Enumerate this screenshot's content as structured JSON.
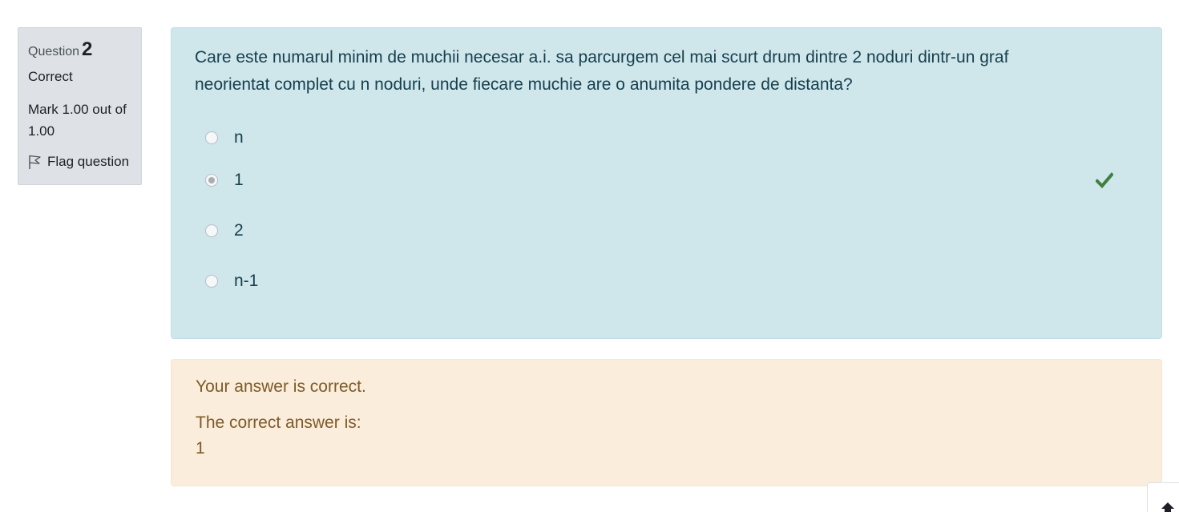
{
  "info": {
    "question_prefix": "Question",
    "question_number": "2",
    "state": "Correct",
    "grade": "Mark 1.00 out of 1.00",
    "flag_label": "Flag question",
    "flag_icon": "flag-icon"
  },
  "question": {
    "text": "Care este numarul minim de muchii necesar a.i. sa parcurgem cel mai scurt drum dintre 2 noduri dintr-un graf neorientat complet cu n noduri, unde fiecare muchie are o anumita pondere de distanta?",
    "answers": [
      {
        "label": "n",
        "selected": false
      },
      {
        "label": "1",
        "selected": true,
        "correct_icon": "check-icon"
      },
      {
        "label": "2",
        "selected": false
      },
      {
        "label": "n-1",
        "selected": false
      }
    ]
  },
  "feedback": {
    "result": "Your answer is correct.",
    "correct_prefix": "The correct answer is:",
    "correct_answer": "1"
  },
  "colors": {
    "question_bg": "#cfe6eb",
    "feedback_bg": "#fbeddb",
    "info_bg": "#dee2e6",
    "check_green": "#3f7f3f"
  },
  "back_to_top_icon": "arrow-up-icon"
}
